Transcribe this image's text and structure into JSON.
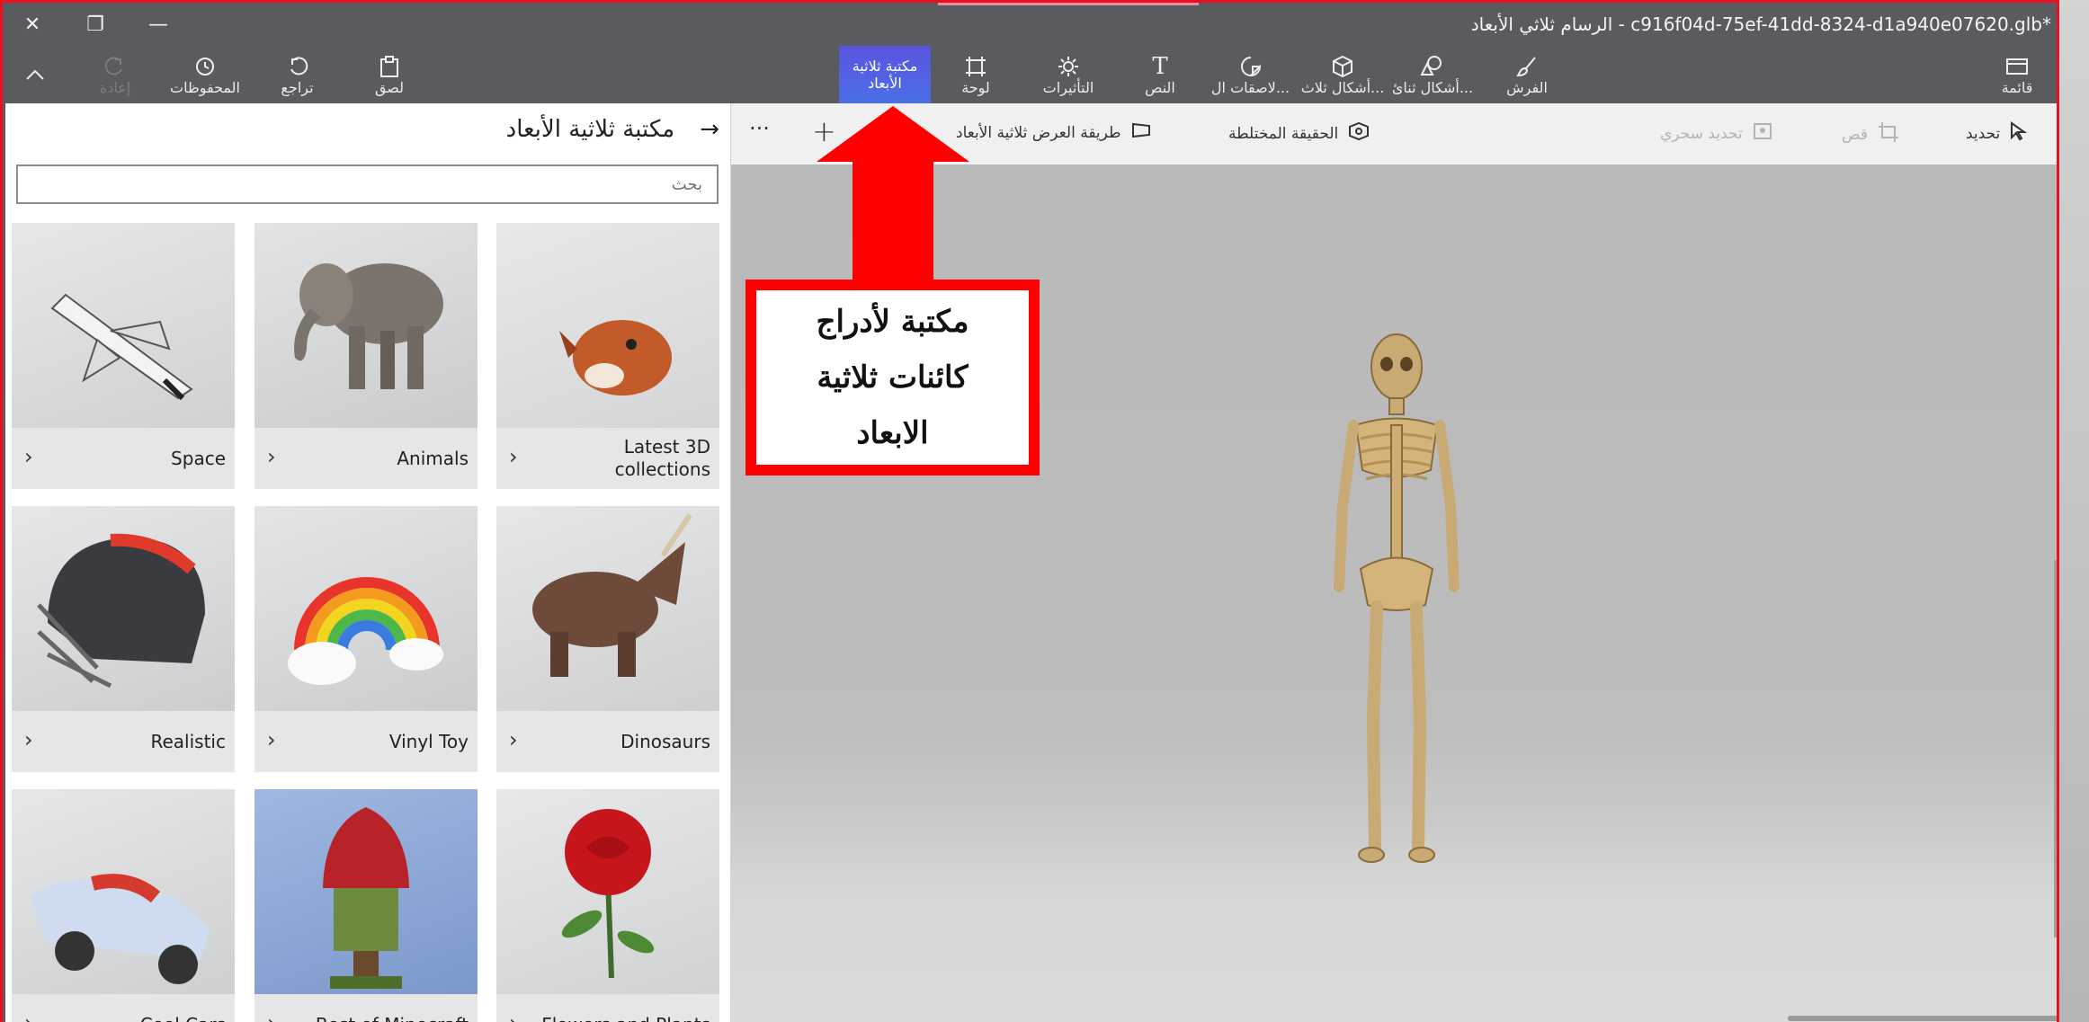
{
  "window": {
    "title": "الرسام ثلاثي الأبعاد - c916f04d-75ef-41dd-8324-d1a940e07620.glb*",
    "close_symbol": "✕",
    "restore_symbol": "❐",
    "minimize_symbol": "—"
  },
  "ribbon": {
    "menu": "قائمة",
    "brushes": "الفرش",
    "shapes_2d": "أشكال ثنائ...",
    "shapes_3d": "أشكال ثلاث...",
    "stickers": "لاصقات ال...",
    "text": "النص",
    "effects": "التأثيرات",
    "canvas": "لوحة",
    "library_3d_line1": "مكتبة ثلاثية",
    "library_3d_line2": "الأبعاد",
    "paste": "لصق",
    "undo": "تراجع",
    "history": "المحفوظات",
    "redo": "إعادة",
    "collapse_symbol": "^"
  },
  "toolbar2": {
    "select": "تحديد",
    "crop": "قص",
    "magic_select": "تحديد سحري",
    "mixed_reality": "الحقيقة المختلطة",
    "view_3d": "طريقة العرض ثلاثية الأبعاد",
    "add_symbol": "+",
    "more_symbol": "···"
  },
  "panel": {
    "title": "مكتبة ثلاثية الأبعاد",
    "back_symbol": "→",
    "search_placeholder": "بحث",
    "tiles": [
      {
        "name": "Latest 3D collections"
      },
      {
        "name": "Animals"
      },
      {
        "name": "Space"
      },
      {
        "name": "Dinosaurs"
      },
      {
        "name": "Vinyl Toy"
      },
      {
        "name": "Realistic"
      },
      {
        "name": "Flowers and Plants"
      },
      {
        "name": "Best of Minecraft"
      },
      {
        "name": "Cool Cars"
      }
    ],
    "chevron": "›"
  },
  "annotation": {
    "line1": "مكتبة لأدراج",
    "line2": "كائنات ثلاثية",
    "line3": "الابعاد"
  },
  "colors": {
    "frame": "#e81123",
    "ribbon_bg": "#5a5b5e",
    "active_tab": "#5c53e0",
    "callout_border": "#ff0000"
  }
}
